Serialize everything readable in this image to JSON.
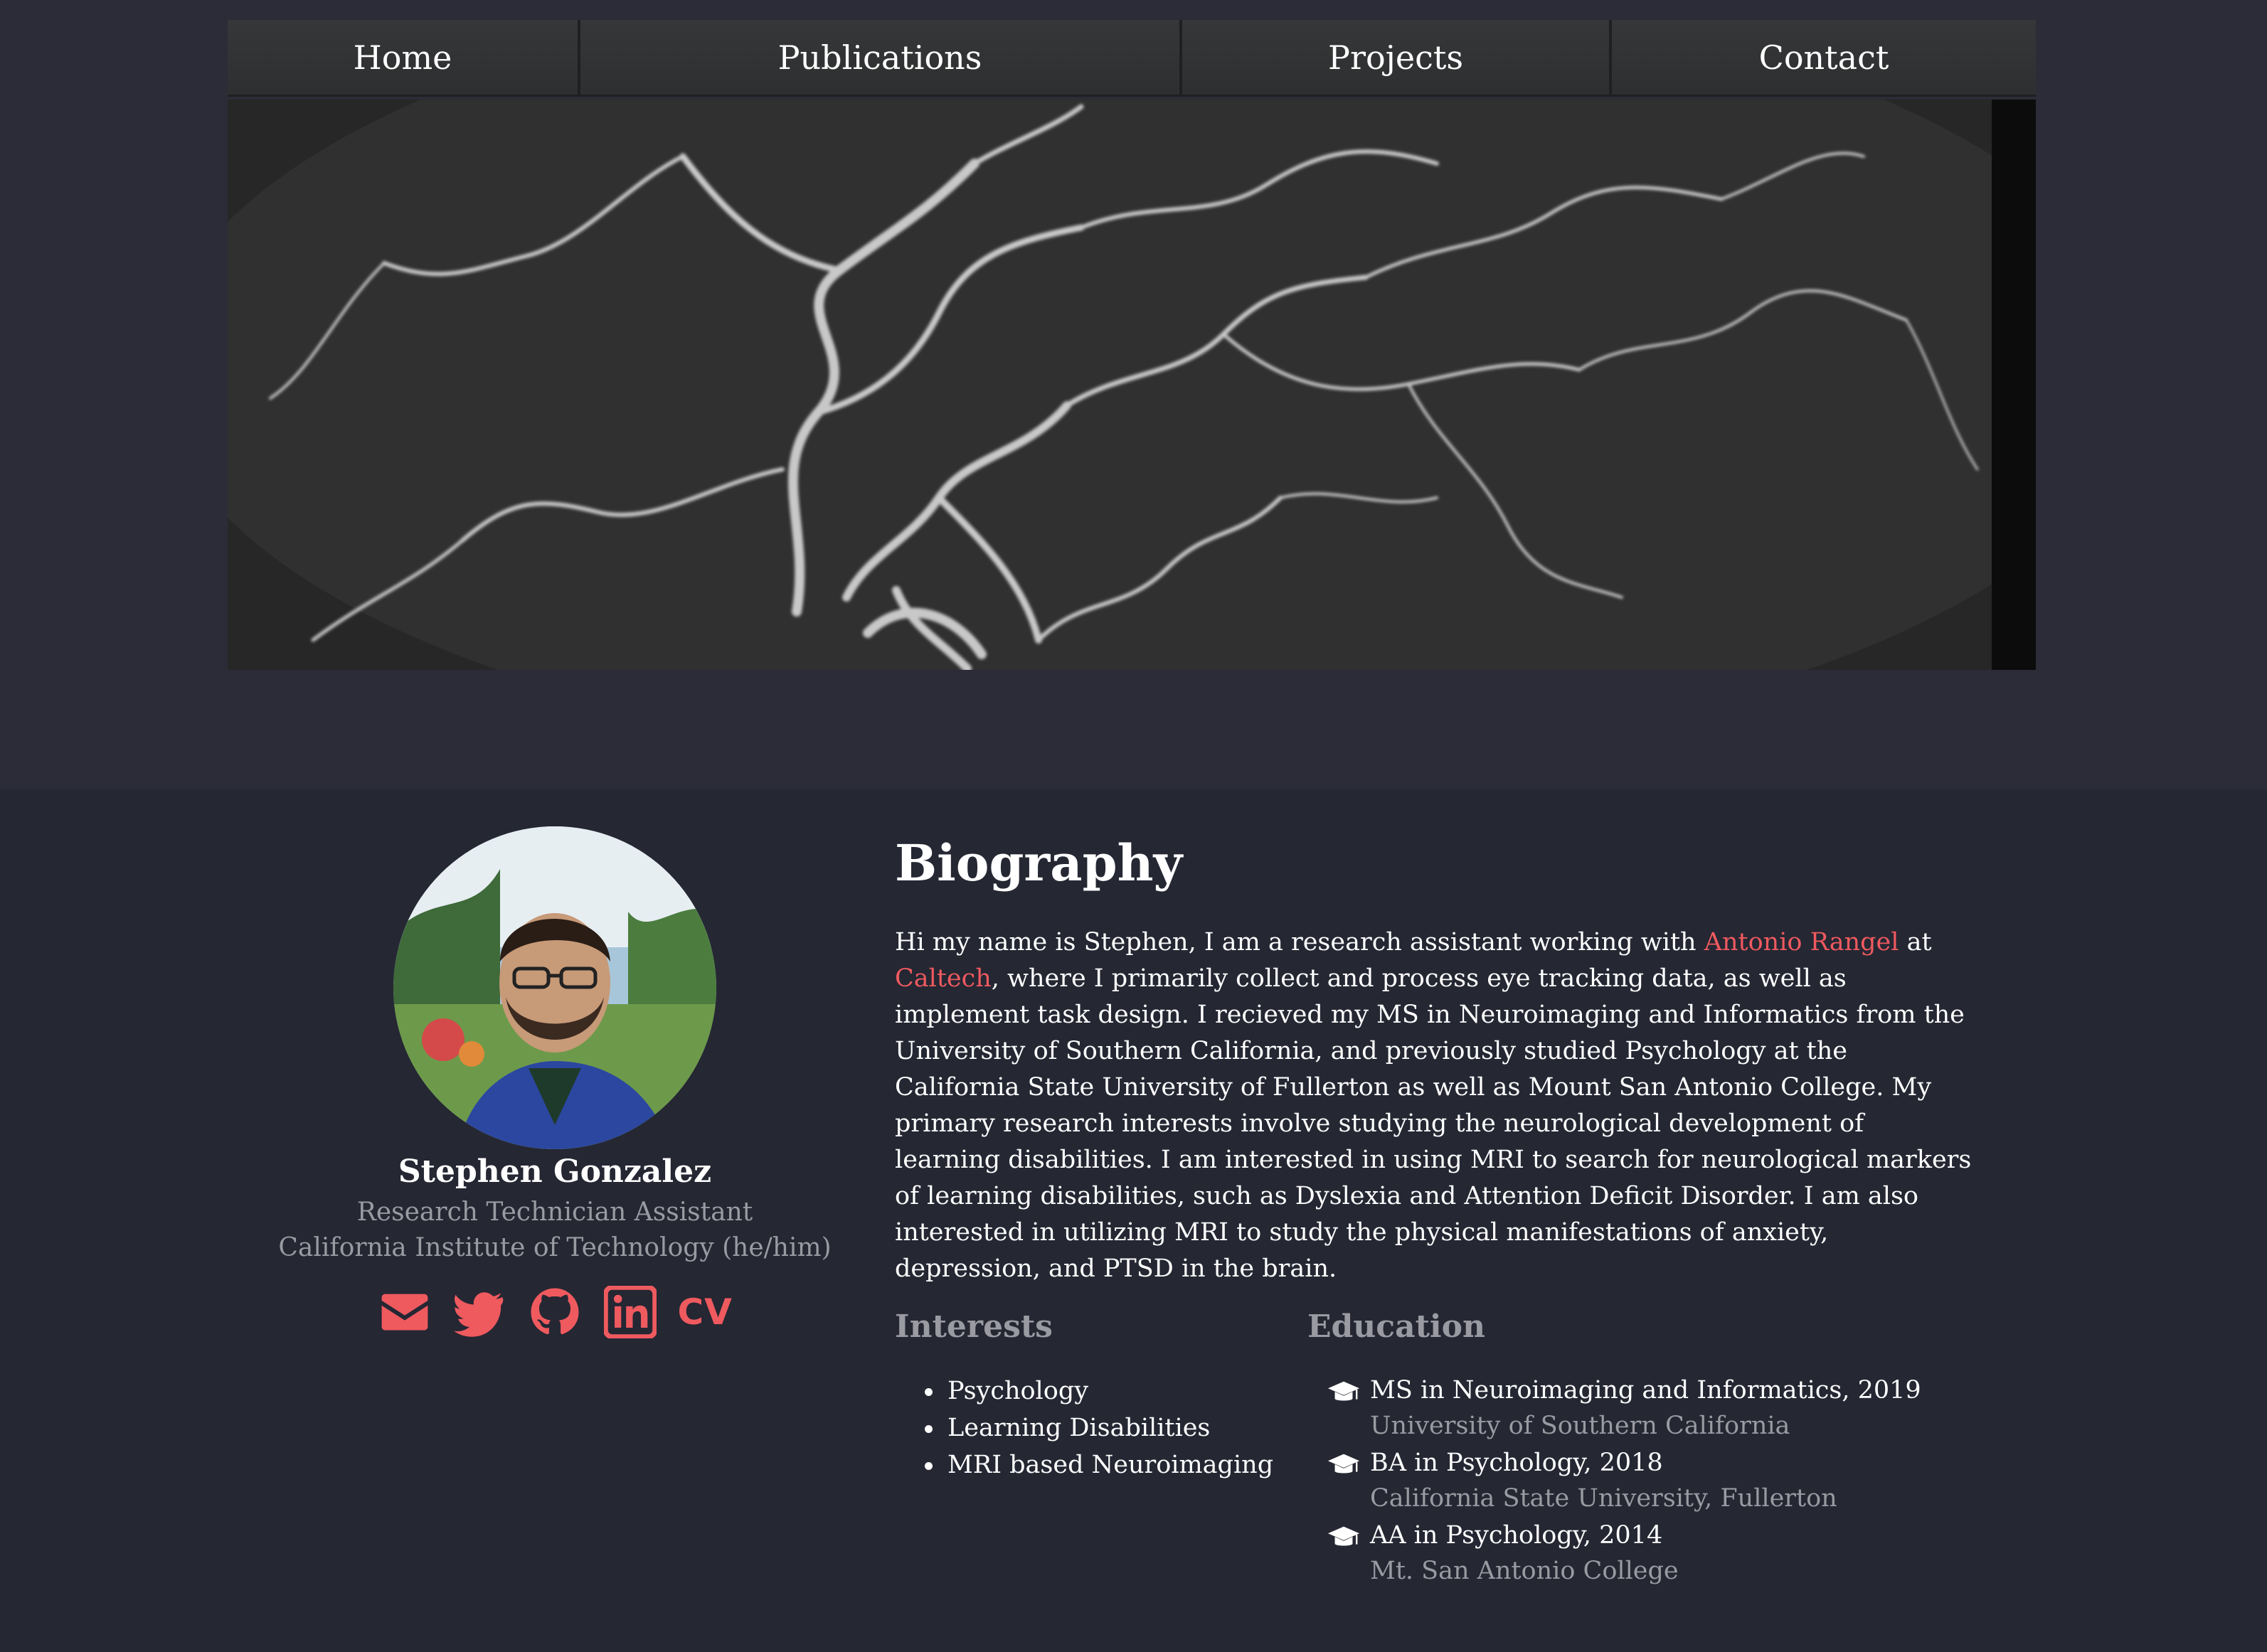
{
  "nav": {
    "items": [
      {
        "label": "Home"
      },
      {
        "label": "Publications"
      },
      {
        "label": "Projects"
      },
      {
        "label": "Contact"
      }
    ]
  },
  "profile": {
    "name": "Stephen Gonzalez",
    "role": "Research Technician Assistant",
    "organization": "California Institute of Technology (he/him)",
    "socials": [
      {
        "icon": "envelope-icon"
      },
      {
        "icon": "twitter-icon"
      },
      {
        "icon": "github-icon"
      },
      {
        "icon": "linkedin-icon"
      },
      {
        "icon": "cv-icon",
        "label": "CV"
      }
    ]
  },
  "biography": {
    "title": "Biography",
    "intro": "Hi my name is Stephen, I am a research assistant working with ",
    "link_advisor": "Antonio Rangel",
    "between": " at ",
    "link_institution": "Caltech",
    "rest": ", where I primarily collect and process eye tracking data, as well as implement task design. I recieved my MS in Neuroimaging and Informatics from the University of Southern California, and previously studied Psychology at the California State University of Fullerton as well as Mount San Antonio College. My primary research interests involve studying the neurological development of learning disabilities. I am interested in using MRI to search for neurological markers of learning disabilities, such as Dyslexia and Attention Deficit Disorder. I am also interested in utilizing MRI to study the physical manifestations of anxiety, depression, and PTSD in the brain."
  },
  "interests": {
    "title": "Interests",
    "items": [
      "Psychology",
      "Learning Disabilities",
      "MRI based Neuroimaging"
    ]
  },
  "education": {
    "title": "Education",
    "items": [
      {
        "degree": "MS in Neuroimaging and Informatics, 2019",
        "school": "University of Southern California"
      },
      {
        "degree": "BA in Psychology, 2018",
        "school": "California State University, Fullerton"
      },
      {
        "degree": "AA in Psychology, 2014",
        "school": "Mt. San Antonio College"
      }
    ]
  },
  "colors": {
    "accent": "#ef5a5f",
    "background": "#252733",
    "muted_text": "#9a9aa2"
  }
}
